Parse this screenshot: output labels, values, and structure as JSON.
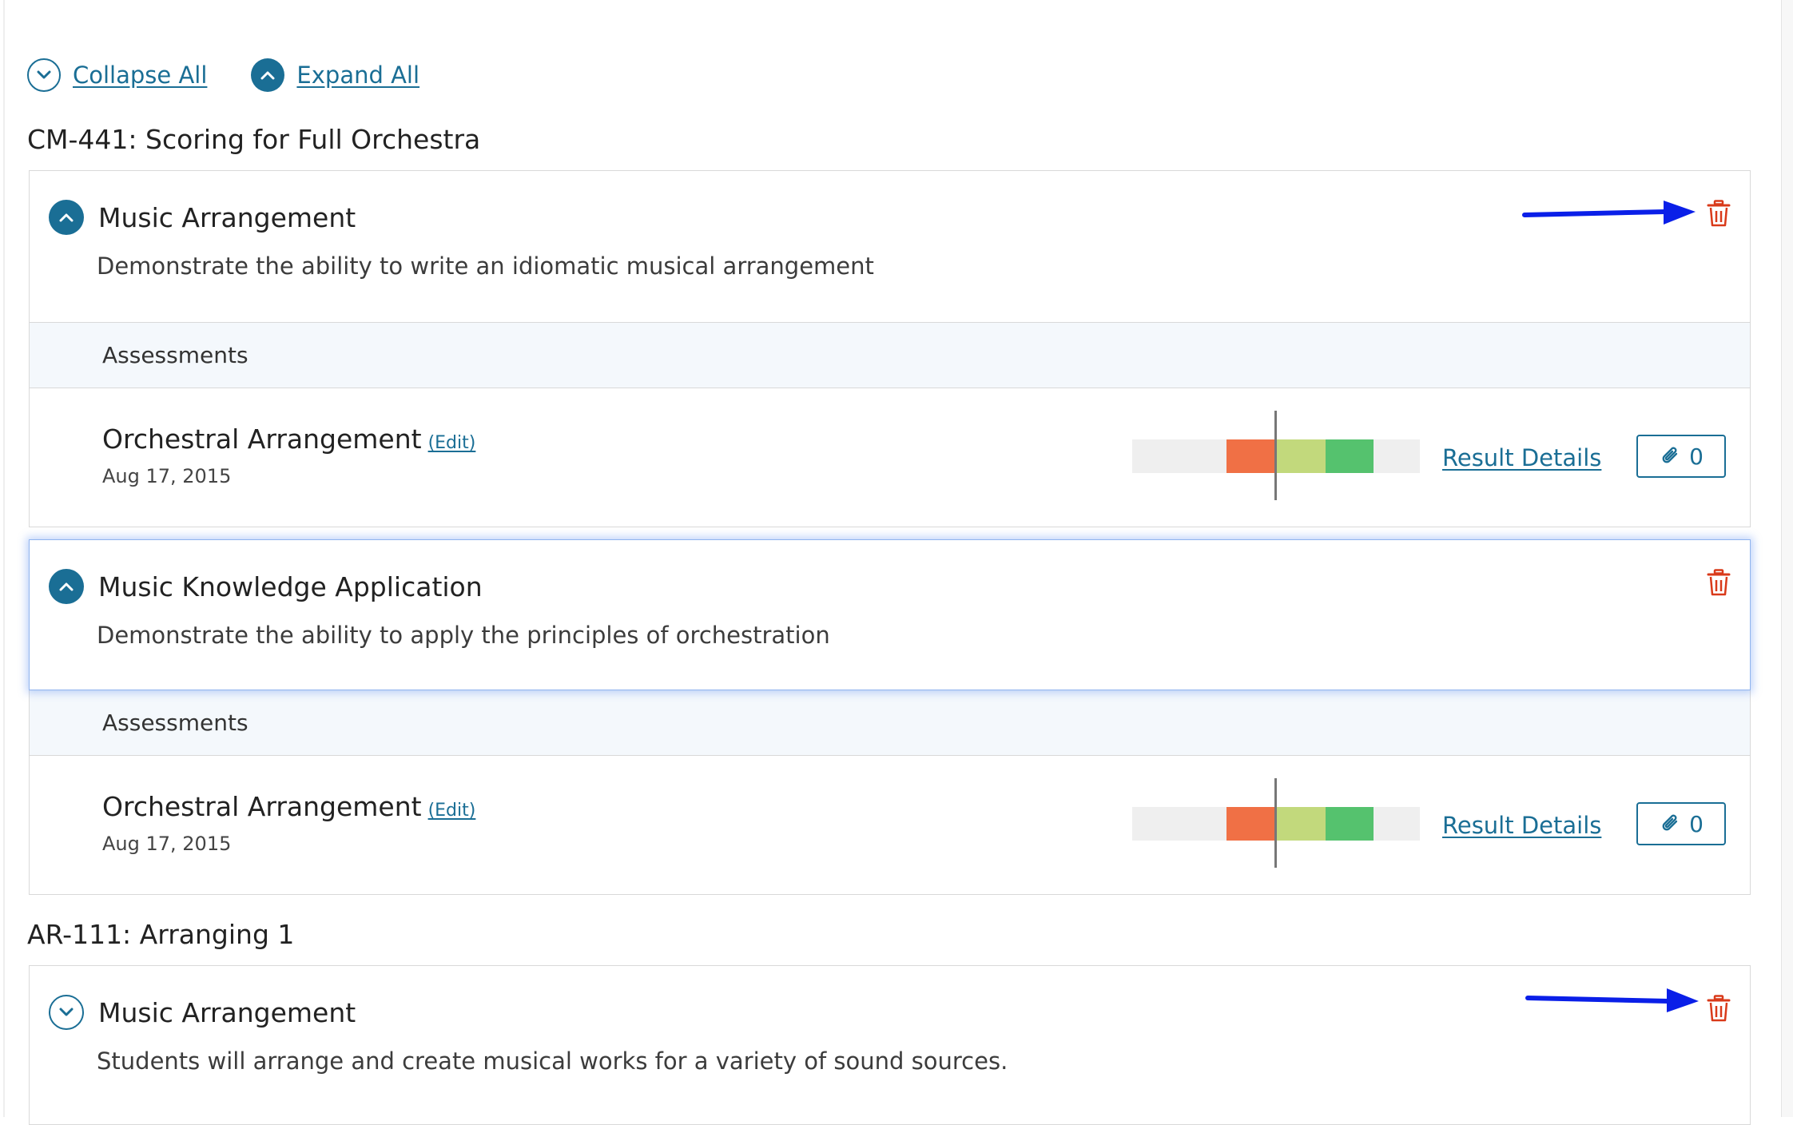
{
  "toolbar": {
    "collapse_all": "Collapse All",
    "expand_all": "Expand All"
  },
  "courses": [
    {
      "heading": "CM-441: Scoring for Full Orchestra",
      "outcomes": [
        {
          "title": "Music Arrangement",
          "description": "Demonstrate the ability to write an idiomatic musical arrangement",
          "expanded": true,
          "assessments_header": "Assessments",
          "assessment": {
            "name": "Orchestral Arrangement",
            "edit": "(Edit)",
            "date": "Aug 17, 2015",
            "result_link": "Result Details",
            "attachments": "0"
          }
        },
        {
          "title": "Music Knowledge Application",
          "description": "Demonstrate the ability to apply the principles of orchestration",
          "expanded": true,
          "assessments_header": "Assessments",
          "assessment": {
            "name": "Orchestral Arrangement",
            "edit": "(Edit)",
            "date": "Aug 17, 2015",
            "result_link": "Result Details",
            "attachments": "0"
          }
        }
      ]
    },
    {
      "heading": "AR-111: Arranging 1",
      "outcomes": [
        {
          "title": "Music Arrangement",
          "description": "Students will arrange and create musical works for a variety of sound sources.",
          "expanded": false
        }
      ]
    }
  ],
  "colors": {
    "accent": "#1a6e95",
    "trash": "#d93a1a",
    "annotation_arrow": "#0a1fe8",
    "bar_below": "#f07045",
    "bar_meets": "#c2d97c",
    "bar_exceeds": "#55c26e",
    "bar_track": "#efefef"
  },
  "icons": {
    "collapse": "chevron-down-circle-icon",
    "expand": "chevron-up-circle-icon",
    "delete": "trash-icon",
    "attachment": "paperclip-icon"
  }
}
